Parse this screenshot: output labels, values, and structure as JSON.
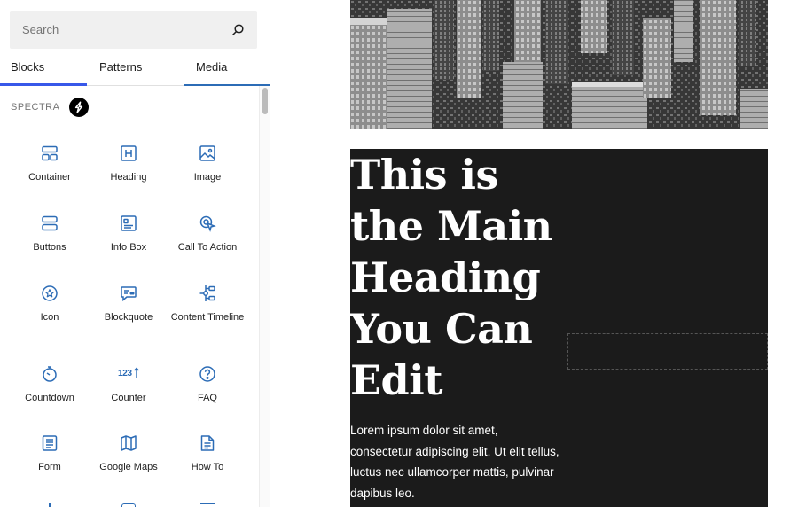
{
  "search": {
    "placeholder": "Search"
  },
  "tabs": [
    {
      "label": "Blocks"
    },
    {
      "label": "Patterns"
    },
    {
      "label": "Media"
    }
  ],
  "category": {
    "title": "SPECTRA",
    "logo_icon": "spectra-bolt-icon"
  },
  "blocks": [
    {
      "label": "Container",
      "icon": "container-icon"
    },
    {
      "label": "Heading",
      "icon": "heading-icon"
    },
    {
      "label": "Image",
      "icon": "image-icon"
    },
    {
      "label": "Buttons",
      "icon": "buttons-icon"
    },
    {
      "label": "Info Box",
      "icon": "info-box-icon"
    },
    {
      "label": "Call To Action",
      "icon": "call-to-action-icon"
    },
    {
      "label": "Icon",
      "icon": "star-circle-icon"
    },
    {
      "label": "Blockquote",
      "icon": "blockquote-icon"
    },
    {
      "label": "Content Timeline",
      "icon": "content-timeline-icon"
    },
    {
      "label": "Countdown",
      "icon": "countdown-icon"
    },
    {
      "label": "Counter",
      "icon": "counter-icon",
      "glyph": "123"
    },
    {
      "label": "FAQ",
      "icon": "faq-icon"
    },
    {
      "label": "Form",
      "icon": "form-icon"
    },
    {
      "label": "Google Maps",
      "icon": "google-maps-icon"
    },
    {
      "label": "How To",
      "icon": "how-to-icon"
    }
  ],
  "editor": {
    "heading": "This is the Main Heading You Can Edit",
    "paragraph": "Lorem ipsum dolor sit amet, consectetur adipiscing elit. Ut elit tellus, luctus nec ullamcorper mattis, pulvinar dapibus leo."
  },
  "colors": {
    "accent": "#3858e9",
    "icon_blue": "#2c6cb6",
    "dark_section": "#1b1b1b",
    "search_bg": "#f0f0f0"
  }
}
